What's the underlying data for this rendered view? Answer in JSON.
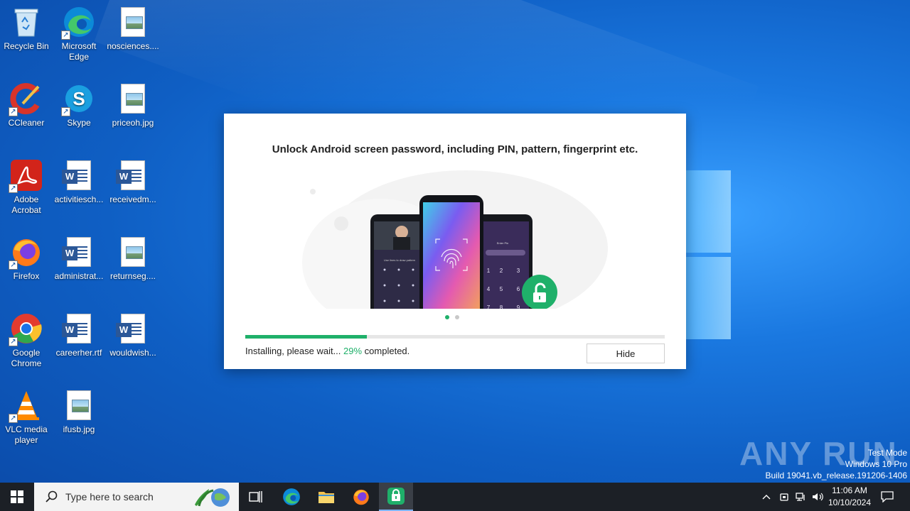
{
  "desktop": {
    "icons": [
      {
        "label": "Recycle Bin"
      },
      {
        "label": "Microsoft Edge"
      },
      {
        "label": "nosciences...."
      },
      {
        "label": "CCleaner"
      },
      {
        "label": "Skype"
      },
      {
        "label": "priceoh.jpg"
      },
      {
        "label": "Adobe Acrobat"
      },
      {
        "label": "activitiesch..."
      },
      {
        "label": "receivedm..."
      },
      {
        "label": "Firefox"
      },
      {
        "label": "administrat..."
      },
      {
        "label": "returnseg...."
      },
      {
        "label": "Google Chrome"
      },
      {
        "label": "careerher.rtf"
      },
      {
        "label": "wouldwish..."
      },
      {
        "label": "VLC media player"
      },
      {
        "label": "ifusb.jpg"
      }
    ]
  },
  "dialog": {
    "title": "Unlock Android screen password, including PIN, pattern, fingerprint etc.",
    "status_prefix": "Installing, please wait... ",
    "percent": "29%",
    "status_suffix": " completed.",
    "progress": 0.29,
    "hide_label": "Hide",
    "carousel": {
      "slides": 2,
      "active": 0
    },
    "phone_left_caption": "Use lines to draw pattern",
    "phone_right_caption": "Enter Pin",
    "keypad": [
      "1",
      "2",
      "3",
      "4",
      "5",
      "6",
      "7",
      "8",
      "9"
    ]
  },
  "watermark": {
    "brand": "ANY RUN",
    "line1": "Test Mode",
    "line2": "Windows 10 Pro",
    "line3": "Build 19041.vb_release.191206-1406"
  },
  "taskbar": {
    "search_placeholder": "Type here to search",
    "time": "11:06 AM",
    "date": "10/10/2024"
  },
  "colors": {
    "accent": "#1fb06a",
    "taskbar": "#1c2026"
  }
}
